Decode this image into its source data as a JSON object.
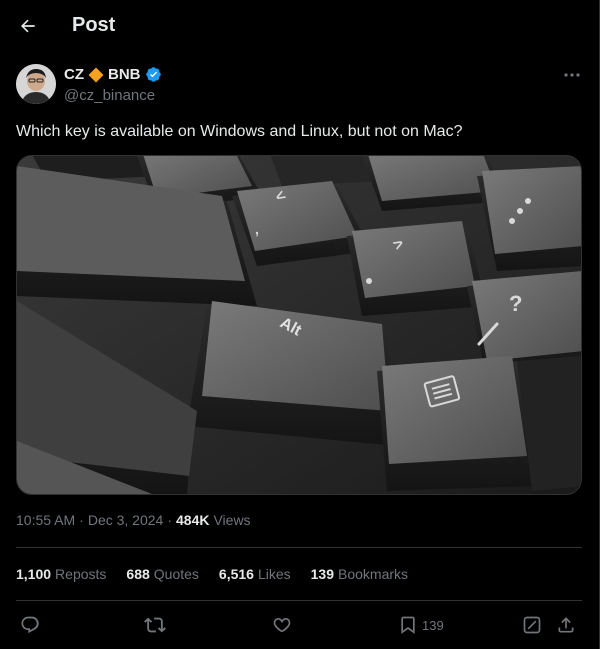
{
  "header": {
    "title": "Post"
  },
  "author": {
    "name": "CZ",
    "name_suffix": "BNB",
    "handle": "@cz_binance"
  },
  "post": {
    "text": "Which key is available on Windows and Linux, but not on Mac?",
    "time": "10:55 AM",
    "date": "Dec 3, 2024",
    "views_count": "484K",
    "views_label": "Views"
  },
  "stats": [
    {
      "count": "1,100",
      "label": "Reposts"
    },
    {
      "count": "688",
      "label": "Quotes"
    },
    {
      "count": "6,516",
      "label": "Likes"
    },
    {
      "count": "139",
      "label": "Bookmarks"
    }
  ],
  "actions": {
    "bookmark_count": "139"
  },
  "media": {
    "keys": [
      "Alt"
    ]
  },
  "colors": {
    "background": "#000000",
    "text_primary": "#e7e9ea",
    "text_secondary": "#71767b",
    "verified_blue": "#1d9bf0",
    "bnb_orange": "#f3a11f",
    "divider": "#2f3336"
  }
}
